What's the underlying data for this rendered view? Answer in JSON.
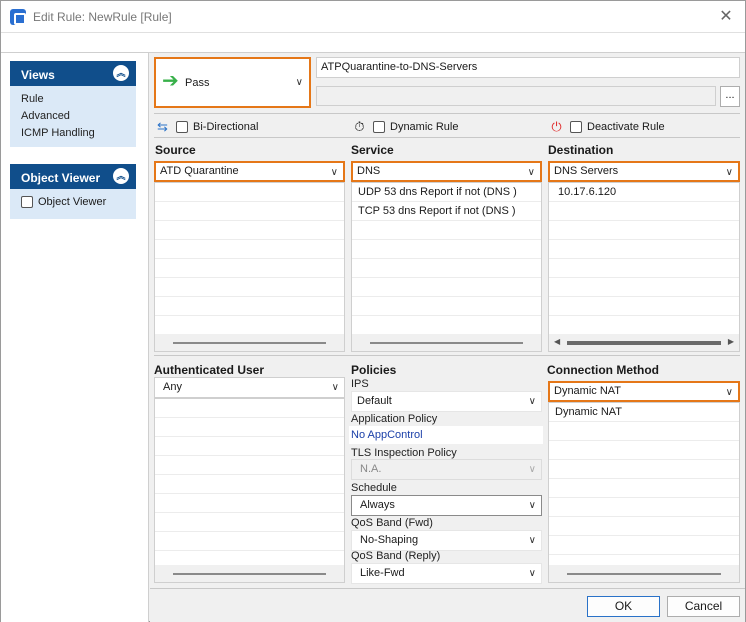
{
  "window": {
    "title": "Edit Rule: NewRule [Rule]"
  },
  "sidebar": {
    "views": {
      "title": "Views",
      "items": [
        {
          "label": "Rule"
        },
        {
          "label": "Advanced"
        },
        {
          "label": "ICMP Handling"
        }
      ]
    },
    "object_viewer": {
      "title": "Object Viewer",
      "checkbox_label": "Object Viewer"
    }
  },
  "rule": {
    "action": "Pass",
    "name": "ATPQuarantine-to-DNS-Servers",
    "more_button": "...",
    "options": {
      "bidirectional": "Bi-Directional",
      "dynamic_rule": "Dynamic Rule",
      "deactivate_rule": "Deactivate Rule"
    }
  },
  "source": {
    "label": "Source",
    "selected": "ATD Quarantine",
    "items": []
  },
  "service": {
    "label": "Service",
    "selected": "DNS",
    "items": [
      "UDP  53 dns  Report if not (DNS )",
      "TCP  53 dns  Report if not (DNS )"
    ]
  },
  "destination": {
    "label": "Destination",
    "selected": "DNS Servers",
    "items": [
      "10.17.6.120"
    ]
  },
  "authenticated_user": {
    "label": "Authenticated User",
    "selected": "Any"
  },
  "policies": {
    "label": "Policies",
    "ips": {
      "label": "IPS",
      "value": "Default"
    },
    "application_policy": {
      "label": "Application Policy",
      "value": "No AppControl"
    },
    "tls_inspection_policy": {
      "label": "TLS Inspection Policy",
      "value": "N.A."
    },
    "schedule": {
      "label": "Schedule",
      "value": "Always"
    },
    "qos_fwd": {
      "label": "QoS Band (Fwd)",
      "value": "No-Shaping"
    },
    "qos_reply": {
      "label": "QoS Band (Reply)",
      "value": "Like-Fwd"
    }
  },
  "connection_method": {
    "label": "Connection Method",
    "selected": "Dynamic NAT",
    "items": [
      "Dynamic NAT"
    ]
  },
  "buttons": {
    "ok": "OK",
    "cancel": "Cancel"
  },
  "colors": {
    "accent_orange": "#e57718",
    "panel_header": "#104e8b",
    "panel_bg": "#dbe9f7",
    "link_blue": "#1a3fa8"
  }
}
